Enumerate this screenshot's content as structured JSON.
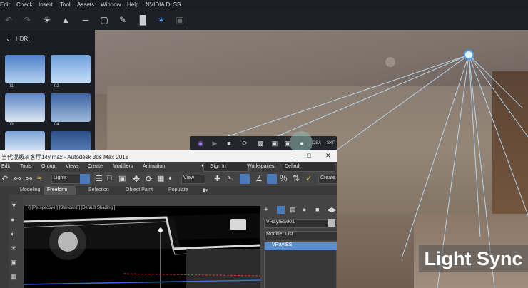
{
  "menubar": {
    "items": [
      "Edit",
      "Check",
      "Insert",
      "Tool",
      "Assets",
      "Window",
      "Help",
      "NVIDIA DLSS"
    ]
  },
  "toolbar": {
    "icons": [
      "undo-icon",
      "redo-icon",
      "sun-icon",
      "cone-light-icon",
      "line-light-icon",
      "rect-light-icon",
      "eyedropper-icon",
      "paint-roller-icon",
      "gizmo-icon",
      "screen-icon"
    ]
  },
  "left_panel": {
    "section_title": "HDRI",
    "thumbnails": [
      {
        "label": "01"
      },
      {
        "label": "02"
      },
      {
        "label": "03"
      },
      {
        "label": "04"
      },
      {
        "label": ""
      },
      {
        "label": ""
      }
    ]
  },
  "capture_bar": {
    "labels": {
      "dsa": "DSA",
      "skp": "SKP"
    }
  },
  "max_window": {
    "title": "当代混级灰客厅14y.max - Autodesk 3ds Max 2018",
    "menu": [
      "Edit",
      "Tools",
      "Group",
      "Views",
      "Create",
      "Modifiers",
      "Animation"
    ],
    "sign_in": "Sign In",
    "workspaces_label": "Workspaces:",
    "workspaces_value": "Default",
    "selection_dropdown": "Lights",
    "view_dropdown": "View",
    "create_sel": "Create S",
    "ribbon": [
      "Modeling",
      "Freeform",
      "Selection",
      "Object Paint",
      "Populate"
    ],
    "viewport_label": "[+] [Perspective ] [Standard ] [Default Shading ]",
    "object_name": "VRayIES001",
    "modifier_list": "Modifier List",
    "modifier_item": "VRayIES"
  },
  "overlay": {
    "light_sync": "Light Sync"
  }
}
